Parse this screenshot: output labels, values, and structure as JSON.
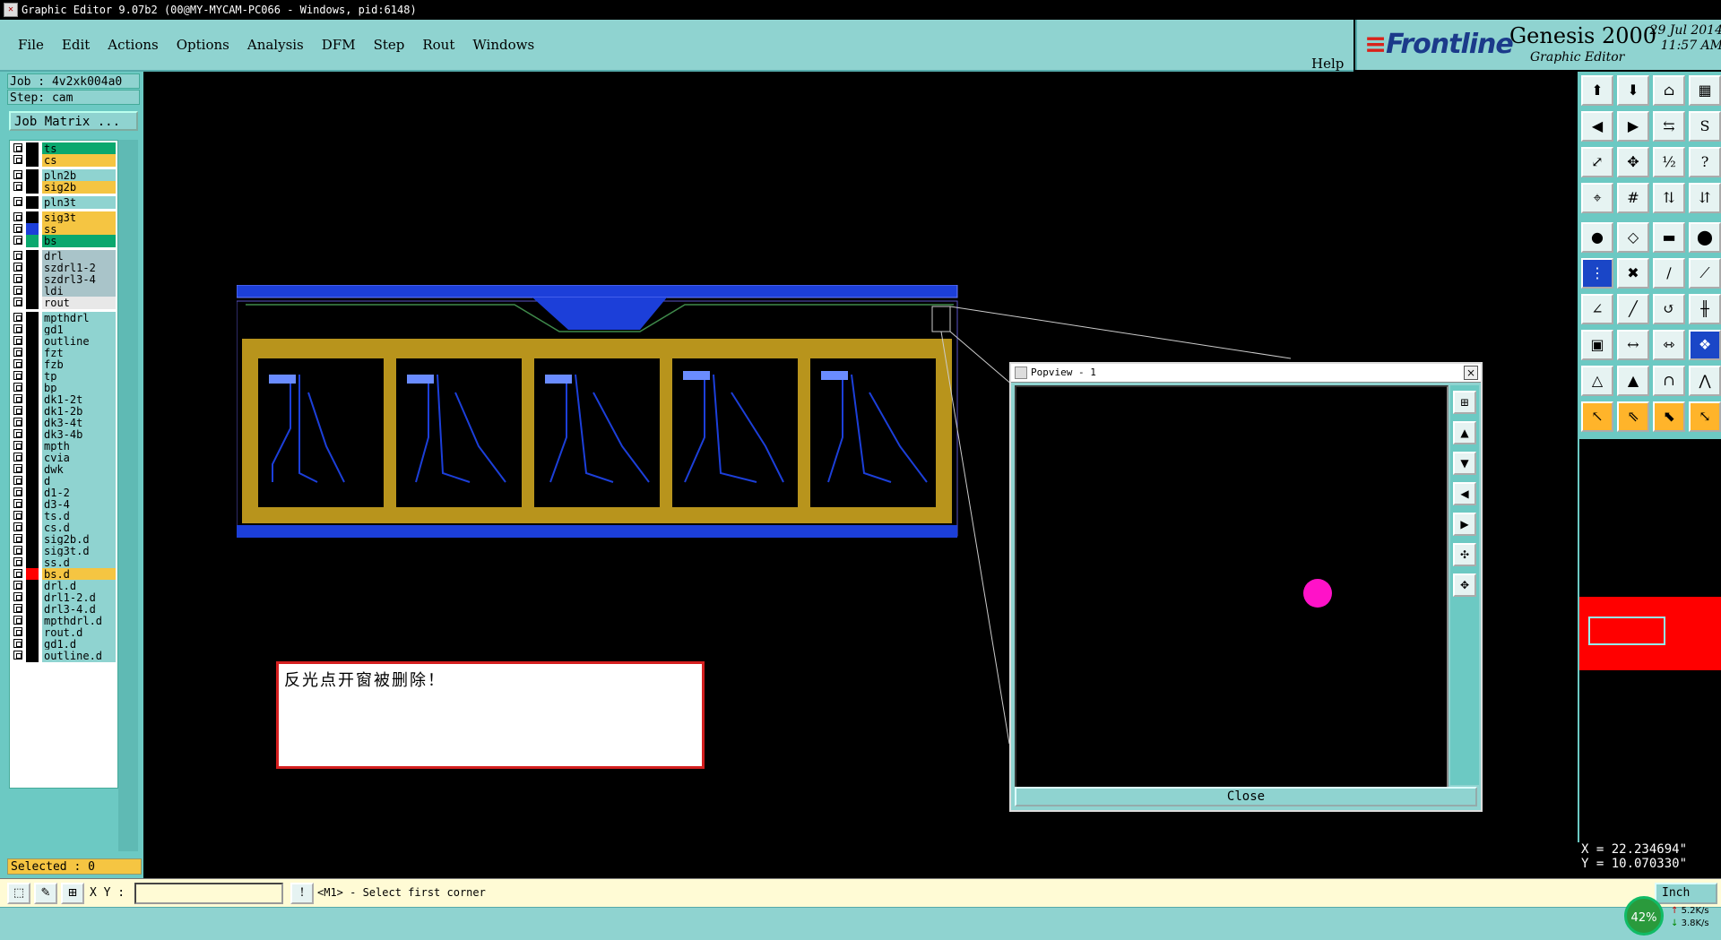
{
  "window": {
    "title": "Graphic Editor 9.07b2 (00@MY-MYCAM-PC066 - Windows, pid:6148)"
  },
  "menu": {
    "items": [
      {
        "label": "File"
      },
      {
        "label": "Edit"
      },
      {
        "label": "Actions"
      },
      {
        "label": "Options"
      },
      {
        "label": "Analysis"
      },
      {
        "label": "DFM"
      },
      {
        "label": "Step"
      },
      {
        "label": "Rout"
      },
      {
        "label": "Windows"
      }
    ],
    "help": "Help"
  },
  "brand": {
    "logo": "Frontline",
    "product": "Genesis 2000",
    "subtitle": "Graphic Editor",
    "date": "29 Jul 2014",
    "time": "11:57 AM"
  },
  "left_panel": {
    "job": "Job : 4v2xk004a0",
    "step": "Step: cam",
    "job_matrix": "Job Matrix ...",
    "selected": "Selected : 0"
  },
  "layers": [
    {
      "name": "ts",
      "color": "#0aa86e"
    },
    {
      "name": "cs",
      "color": "#f5c542"
    },
    {
      "name": "pln2b",
      "color": "#8fd3d0"
    },
    {
      "name": "sig2b",
      "color": "#f5c542"
    },
    {
      "name": "pln3t",
      "color": "#8fd3d0"
    },
    {
      "name": "sig3t",
      "color": "#f5c542"
    },
    {
      "name": "ss",
      "color": "#f5c542"
    },
    {
      "name": "bs",
      "color": "#0aa86e"
    },
    {
      "name": "drl",
      "color": "#a9c4c9"
    },
    {
      "name": "szdrl1-2",
      "color": "#a9c4c9"
    },
    {
      "name": "szdrl3-4",
      "color": "#a9c4c9"
    },
    {
      "name": "ldi",
      "color": "#a9c4c9"
    },
    {
      "name": "rout",
      "color": "#e8e8e8"
    },
    {
      "name": "mpthdrl",
      "color": "#8fd3d0"
    },
    {
      "name": "gd1",
      "color": "#8fd3d0"
    },
    {
      "name": "outline",
      "color": "#8fd3d0"
    },
    {
      "name": "fzt",
      "color": "#8fd3d0"
    },
    {
      "name": "fzb",
      "color": "#8fd3d0"
    },
    {
      "name": "tp",
      "color": "#8fd3d0"
    },
    {
      "name": "bp",
      "color": "#8fd3d0"
    },
    {
      "name": "dk1-2t",
      "color": "#8fd3d0"
    },
    {
      "name": "dk1-2b",
      "color": "#8fd3d0"
    },
    {
      "name": "dk3-4t",
      "color": "#8fd3d0"
    },
    {
      "name": "dk3-4b",
      "color": "#8fd3d0"
    },
    {
      "name": "mpth",
      "color": "#8fd3d0"
    },
    {
      "name": "cvia",
      "color": "#8fd3d0"
    },
    {
      "name": "dwk",
      "color": "#8fd3d0"
    },
    {
      "name": "d",
      "color": "#8fd3d0"
    },
    {
      "name": "d1-2",
      "color": "#8fd3d0"
    },
    {
      "name": "d3-4",
      "color": "#8fd3d0"
    },
    {
      "name": "ts.d",
      "color": "#8fd3d0"
    },
    {
      "name": "cs.d",
      "color": "#8fd3d0"
    },
    {
      "name": "sig2b.d",
      "color": "#8fd3d0"
    },
    {
      "name": "sig3t.d",
      "color": "#8fd3d0"
    },
    {
      "name": "ss.d",
      "color": "#8fd3d0"
    },
    {
      "name": "bs.d",
      "color": "#f5c542"
    },
    {
      "name": "drl.d",
      "color": "#8fd3d0"
    },
    {
      "name": "drl1-2.d",
      "color": "#8fd3d0"
    },
    {
      "name": "drl3-4.d",
      "color": "#8fd3d0"
    },
    {
      "name": "mpthdrl.d",
      "color": "#8fd3d0"
    },
    {
      "name": "rout.d",
      "color": "#8fd3d0"
    },
    {
      "name": "gd1.d",
      "color": "#8fd3d0"
    },
    {
      "name": "outline.d",
      "color": "#8fd3d0"
    }
  ],
  "message_box": {
    "text": "反光点开窗被删除！"
  },
  "popview": {
    "title": "Popview - 1",
    "close_label": "Close",
    "close_x": "×"
  },
  "coords": {
    "x": "X = 22.234694\"",
    "y": "Y = 10.070330\""
  },
  "status": {
    "xy_label": "X Y :",
    "xy_value": "",
    "prompt": "<M1> - Select first corner",
    "unit": "Inch"
  },
  "net": {
    "cpu": "42%",
    "up": "5.2K/s",
    "down": "3.8K/s"
  },
  "colors": {
    "panel": "#8fd3d0",
    "copper": "#b8941c",
    "trace": "#1c3fd9",
    "popview_pad": "#ff12c8"
  }
}
